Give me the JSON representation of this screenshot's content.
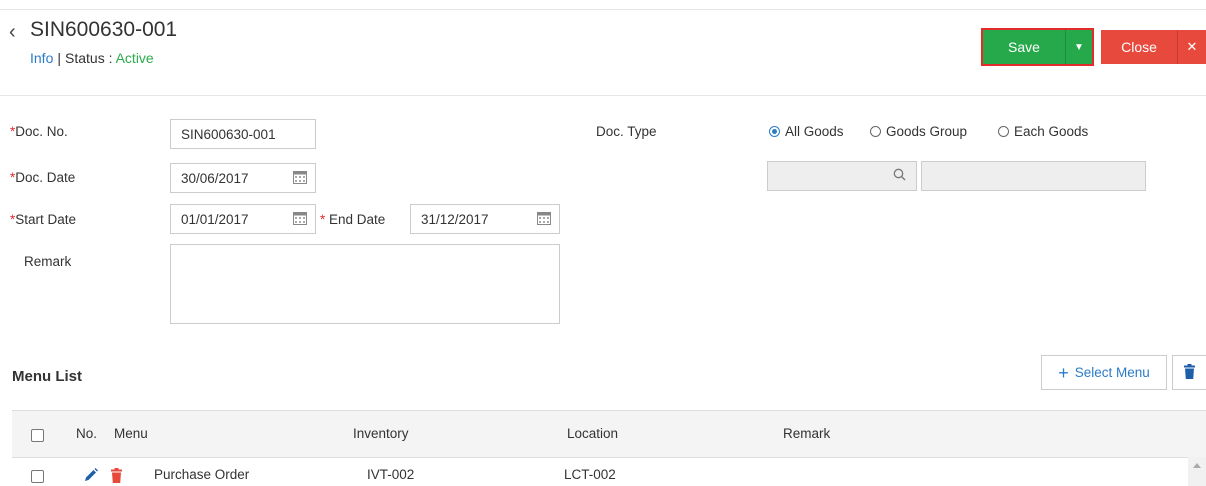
{
  "header": {
    "title": "SIN600630-001",
    "info_link": "Info",
    "separator": "|",
    "status_label": "Status :",
    "status_value": "Active",
    "save_label": "Save",
    "close_label": "Close"
  },
  "form": {
    "doc_no": {
      "label": "Doc. No.",
      "value": "SIN600630-001"
    },
    "doc_date": {
      "label": "Doc. Date",
      "value": "30/06/2017"
    },
    "start_date": {
      "label": "Start Date",
      "value": "01/01/2017"
    },
    "end_date": {
      "label": "End Date",
      "value": "31/12/2017"
    },
    "remark": {
      "label": "Remark",
      "value": ""
    },
    "doc_type": {
      "label": "Doc. Type",
      "options": [
        "All Goods",
        "Goods Group",
        "Each Goods"
      ],
      "selected": "All Goods"
    },
    "required_mark": "*"
  },
  "menu_list": {
    "title": "Menu List",
    "select_menu_label": "Select Menu",
    "columns": [
      "No.",
      "Menu",
      "Inventory",
      "Location",
      "Remark"
    ],
    "rows": [
      {
        "menu": "Purchase Order",
        "inventory": "IVT-002",
        "location": "LCT-002",
        "remark": ""
      }
    ]
  },
  "colors": {
    "save": "#25a94a",
    "close": "#e8493d",
    "link": "#2a7cc7",
    "active": "#2eab4f",
    "required": "#e22c2c"
  }
}
